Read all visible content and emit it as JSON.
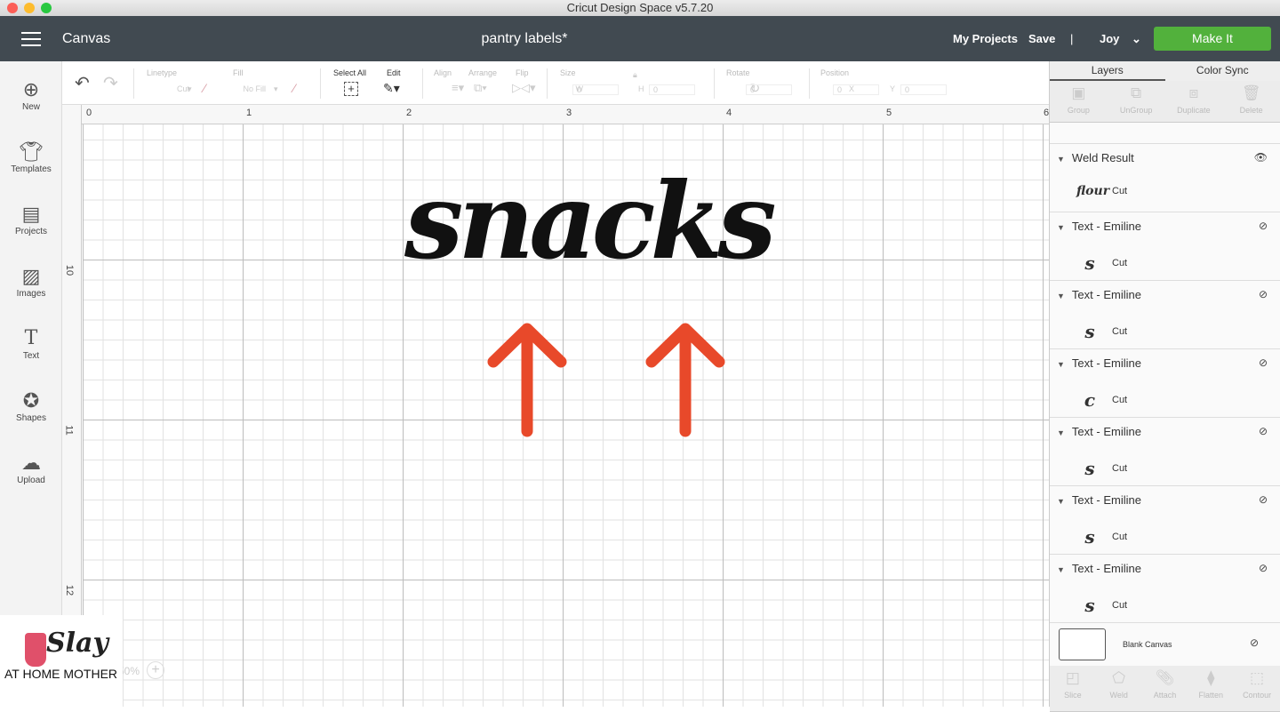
{
  "window": {
    "title": "Cricut Design Space  v5.7.20"
  },
  "header": {
    "section": "Canvas",
    "project": "pantry labels*",
    "my_projects": "My Projects",
    "save": "Save",
    "divider": "|",
    "user": "Joy",
    "make_it": "Make It",
    "make_it_color": "#52b13c"
  },
  "toolbar": {
    "linetype_label": "Linetype",
    "linetype_value": "Cut",
    "fill_label": "Fill",
    "fill_value": "No Fill",
    "select_all": "Select All",
    "edit": "Edit",
    "align": "Align",
    "arrange": "Arrange",
    "flip": "Flip",
    "size": "Size",
    "w": "W",
    "h": "H",
    "w_value": "0",
    "h_value": "0",
    "rotate": "Rotate",
    "rotate_value": "0",
    "position": "Position",
    "x": "X",
    "y": "Y",
    "x_value": "0",
    "y_value": "0"
  },
  "sidebar": {
    "items": [
      {
        "label": "New",
        "icon": "plus-circle-icon"
      },
      {
        "label": "Templates",
        "icon": "shirt-icon"
      },
      {
        "label": "Projects",
        "icon": "notebook-icon"
      },
      {
        "label": "Images",
        "icon": "image-icon"
      },
      {
        "label": "Text",
        "icon": "text-icon"
      },
      {
        "label": "Shapes",
        "icon": "shapes-icon"
      },
      {
        "label": "Upload",
        "icon": "cloud-upload-icon"
      }
    ]
  },
  "ruler": {
    "h": [
      "0",
      "1",
      "2",
      "3",
      "4",
      "5",
      "6"
    ],
    "v": [
      "10",
      "11",
      "12"
    ]
  },
  "canvas": {
    "text": "snacks",
    "arrow_color": "#e8492a",
    "zoom": "50%"
  },
  "panel": {
    "tabs": [
      "Layers",
      "Color Sync"
    ],
    "tools": [
      "Group",
      "UnGroup",
      "Duplicate",
      "Delete"
    ],
    "layers": [
      {
        "name": "Weld Result",
        "thumb": "flour",
        "op": "Cut",
        "visible": true
      },
      {
        "name": "Text - Emiline",
        "thumb": "s",
        "op": "Cut",
        "visible": false
      },
      {
        "name": "Text - Emiline",
        "thumb": "s",
        "op": "Cut",
        "visible": false
      },
      {
        "name": "Text - Emiline",
        "thumb": "c",
        "op": "Cut",
        "visible": false
      },
      {
        "name": "Text - Emiline",
        "thumb": "s",
        "op": "Cut",
        "visible": false
      },
      {
        "name": "Text - Emiline",
        "thumb": "s",
        "op": "Cut",
        "visible": false
      },
      {
        "name": "Text - Emiline",
        "thumb": "s",
        "op": "Cut",
        "visible": false
      }
    ],
    "blank_canvas": "Blank Canvas",
    "bottom_tools": [
      "Slice",
      "Weld",
      "Attach",
      "Flatten",
      "Contour"
    ]
  },
  "watermark": {
    "line1": "Slay",
    "line2": "AT HOME MOTHER"
  }
}
